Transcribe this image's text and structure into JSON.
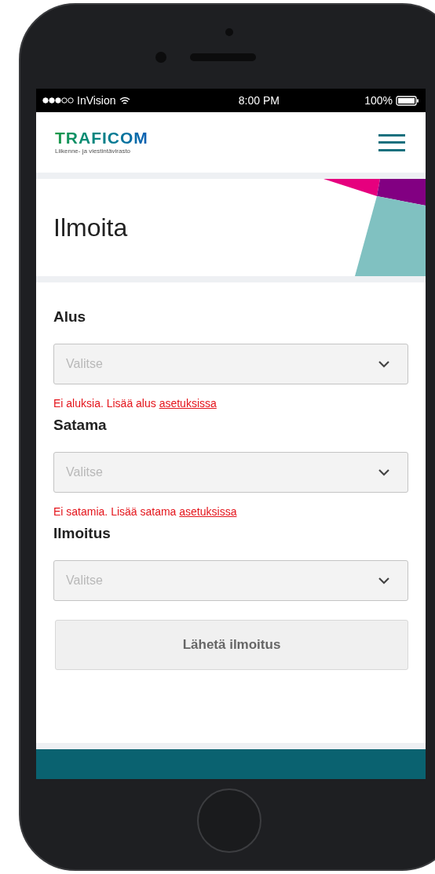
{
  "status_bar": {
    "carrier": "InVision",
    "time": "8:00 PM",
    "battery": "100%"
  },
  "header": {
    "logo": "TRAFICOM",
    "logo_subtitle": "Liikenne- ja viestintävirasto"
  },
  "page_title": "Ilmoita",
  "fields": [
    {
      "label": "Alus",
      "placeholder": "Valitse",
      "error": {
        "text": "Ei aluksia. Lisää alus",
        "link": "asetuksissa"
      }
    },
    {
      "label": "Satama",
      "placeholder": "Valitse",
      "error": {
        "text": "Ei satamia. Lisää satama",
        "link": "asetuksissa"
      }
    },
    {
      "label": "Ilmoitus",
      "placeholder": "Valitse"
    }
  ],
  "submit": {
    "label": "Lähetä ilmoitus",
    "disabled": true
  }
}
